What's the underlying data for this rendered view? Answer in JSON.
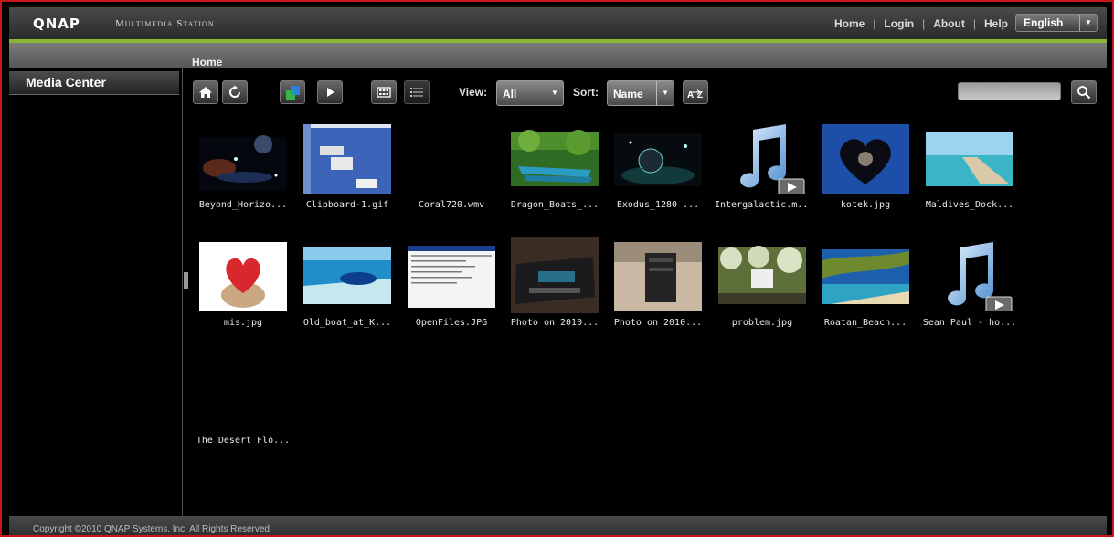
{
  "header": {
    "logo": "QNAP",
    "app_title": "Multimedia Station",
    "nav": [
      {
        "label": "Home"
      },
      {
        "label": "Login"
      },
      {
        "label": "About"
      },
      {
        "label": "Help"
      }
    ],
    "language": "English",
    "accent_color": "#8bb432",
    "border_color": "#c8161d"
  },
  "breadcrumb": "Home",
  "sidebar": {
    "title": "Media Center"
  },
  "toolbar": {
    "icons": [
      "home-icon",
      "refresh-icon",
      "slideshow-icon",
      "play-icon",
      "thumbnail-view-icon",
      "list-view-icon",
      "sort-az-icon",
      "search-icon"
    ],
    "view_label": "View:",
    "view_value": "All",
    "sort_label": "Sort:",
    "sort_value": "Name",
    "sort_order_label": "AZ"
  },
  "items": [
    {
      "name": "Beyond_Horizo...",
      "type": "image"
    },
    {
      "name": "Clipboard-1.gif",
      "type": "image"
    },
    {
      "name": "Coral720.wmv",
      "type": "video"
    },
    {
      "name": "Dragon_Boats_...",
      "type": "image"
    },
    {
      "name": "Exodus_1280 ...",
      "type": "image"
    },
    {
      "name": "Intergalactic.m...",
      "type": "music"
    },
    {
      "name": "kotek.jpg",
      "type": "image"
    },
    {
      "name": "Maldives_Dock...",
      "type": "image"
    },
    {
      "name": "mis.jpg",
      "type": "image"
    },
    {
      "name": "Old_boat_at_K...",
      "type": "image"
    },
    {
      "name": "OpenFiles.JPG",
      "type": "image"
    },
    {
      "name": "Photo on 2010...",
      "type": "image"
    },
    {
      "name": "Photo on 2010...",
      "type": "image"
    },
    {
      "name": "problem.jpg",
      "type": "image"
    },
    {
      "name": "Roatan_Beach...",
      "type": "image"
    },
    {
      "name": "Sean Paul - ho...",
      "type": "music"
    },
    {
      "name": "The Desert Flo...",
      "type": "video"
    }
  ],
  "footer": {
    "copyright": "Copyright ©2010 QNAP Systems, Inc. All Rights Reserved."
  }
}
